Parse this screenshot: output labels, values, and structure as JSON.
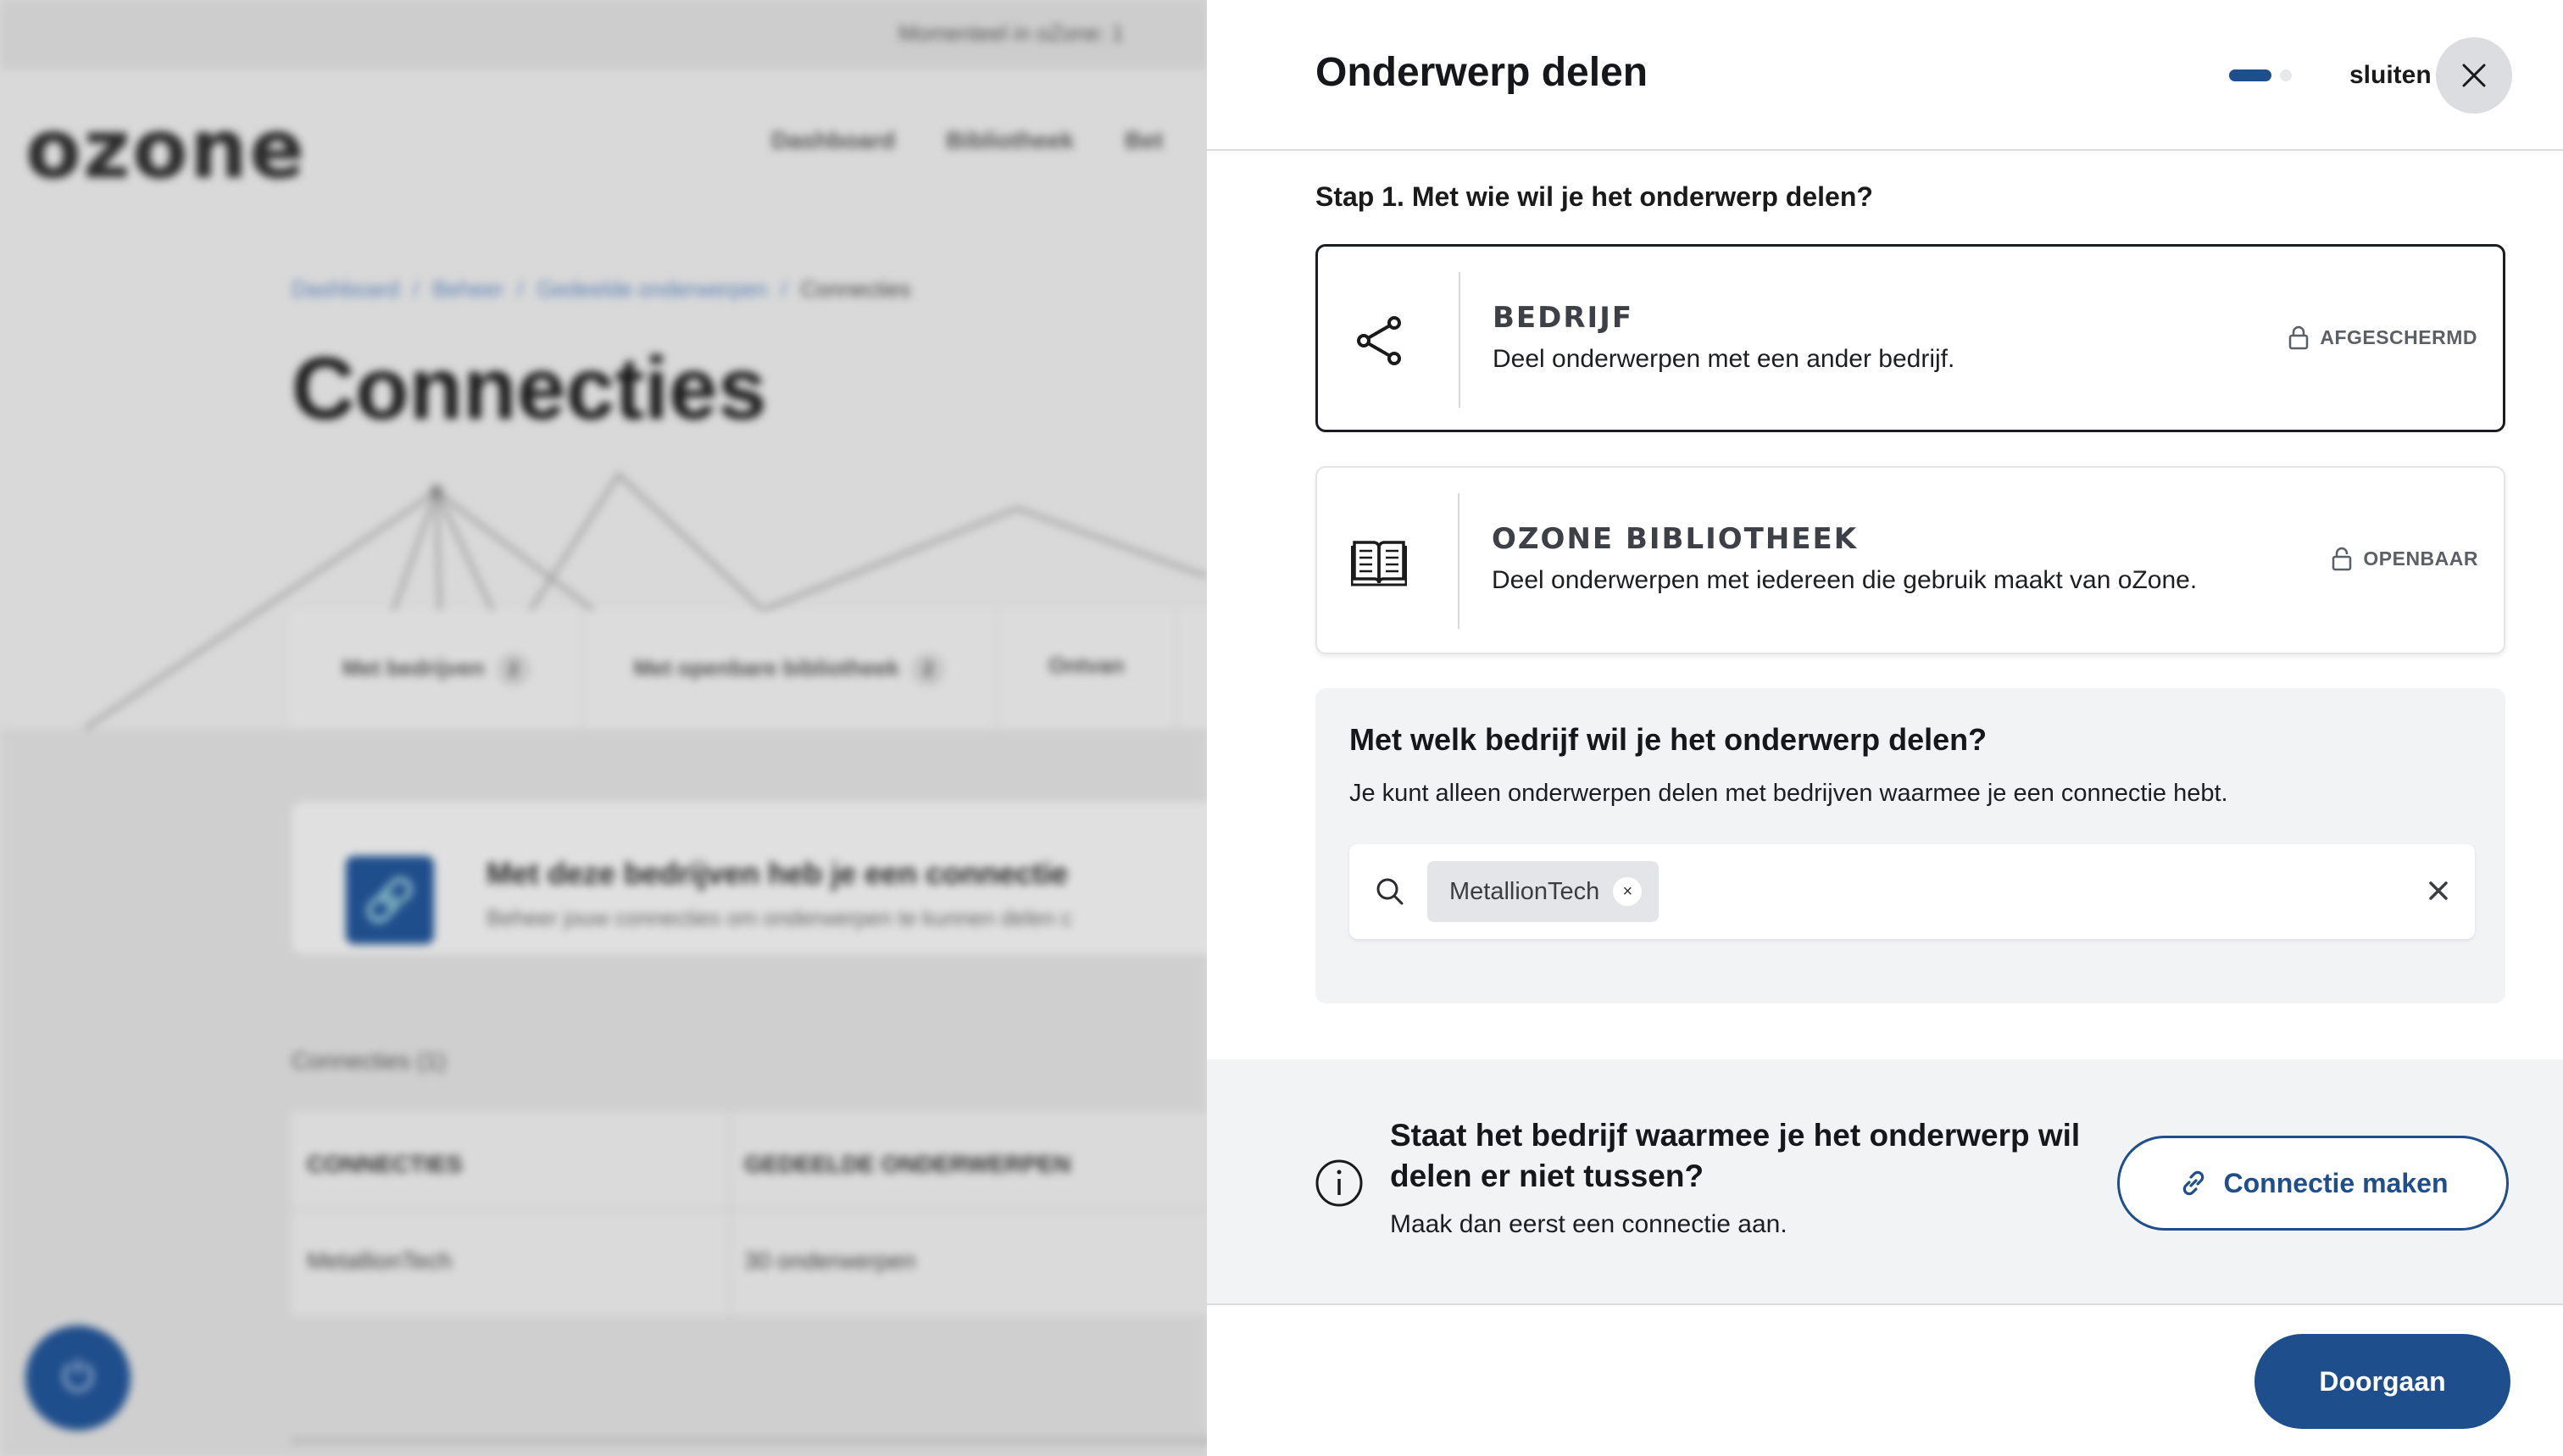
{
  "background": {
    "announcement": "Momenteel in oZone: 1",
    "logo_text": "ozone",
    "nav": [
      "Dashboard",
      "Bibliotheek",
      "Bet"
    ],
    "breadcrumb": [
      "Dashboard",
      "Beheer",
      "Gedeelde onderwerpen",
      "Connecties"
    ],
    "breadcrumb_sep": "/",
    "page_title": "Connecties",
    "tabs": [
      {
        "label": "Met bedrijven",
        "count": "2"
      },
      {
        "label": "Met openbare bibliotheek",
        "count": "2"
      },
      {
        "label": "Ontvan",
        "count": ""
      }
    ],
    "connection_card": {
      "title": "Met deze bedrijven heb je een connectie",
      "subtitle": "Beheer jouw connecties om onderwerpen te kunnen delen c"
    },
    "connections_label": "Connecties (1)",
    "table": {
      "headers": [
        "CONNECTIES",
        "GEDEELDE ONDERWERPEN"
      ],
      "rows": [
        [
          "MetallionTech",
          "30 onderwerpen"
        ]
      ]
    }
  },
  "drawer": {
    "title": "Onderwerp delen",
    "step_total": 2,
    "step_current": 1,
    "close_label": "sluiten",
    "step_question": "Stap 1. Met wie wil je het onderwerp delen?",
    "options": [
      {
        "icon": "share-icon",
        "title": "BEDRIJF",
        "description": "Deel onderwerpen met een ander bedrijf.",
        "badge": "AFGESCHERMD",
        "badge_icon": "lock-icon",
        "selected": true
      },
      {
        "icon": "book-icon",
        "title": "OZONE BIBLIOTHEEK",
        "description": "Deel onderwerpen met iedereen die gebruik maakt van oZone.",
        "badge": "OPENBAAR",
        "badge_icon": "unlock-icon",
        "selected": false
      }
    ],
    "company_select": {
      "heading": "Met welk bedrijf wil je het onderwerp delen?",
      "subtext": "Je kunt alleen onderwerpen delen met bedrijven waarmee je een connectie hebt.",
      "selected_chip": "MetallionTech",
      "chip_remove": "×"
    },
    "info": {
      "heading": "Staat het bedrijf waarmee je het onderwerp wil delen er niet tussen?",
      "subtext": "Maak dan eerst een connectie aan.",
      "button_label": "Connectie maken"
    },
    "next_button": "Doorgaan"
  },
  "colors": {
    "primary": "#1f4e8c",
    "overlay_grey": "#d4d4d4",
    "panel_grey": "#f2f3f5"
  }
}
